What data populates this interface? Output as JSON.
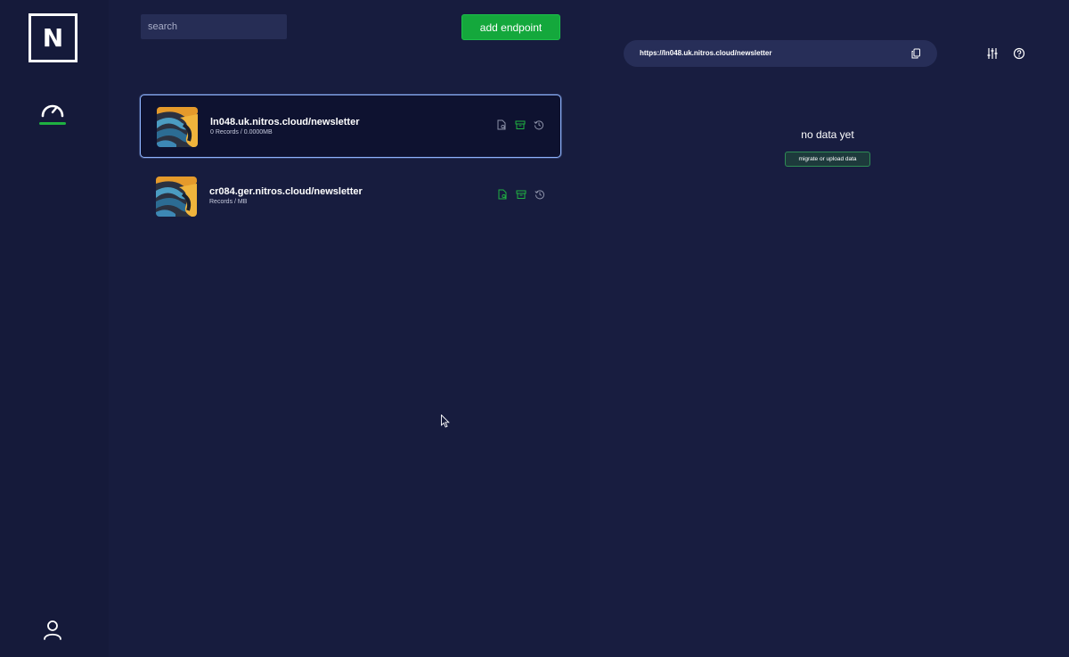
{
  "sidebar": {
    "logo_letter": "N",
    "nav": [
      {
        "icon": "speedometer-icon",
        "active": true
      }
    ],
    "account_icon": "user-icon",
    "accent": "#1fb141"
  },
  "toolbar": {
    "search_placeholder": "search",
    "add_label": "add endpoint",
    "add_color": "#14a83c"
  },
  "endpoints": [
    {
      "title": "ln048.uk.nitros.cloud/newsletter",
      "subtitle": "0 Records / 0.0000MB",
      "selected": true,
      "actions_color": "#1fb141"
    },
    {
      "title": "cr084.ger.nitros.cloud/newsletter",
      "subtitle": "Records / MB",
      "selected": false,
      "actions_color": "#1fb141"
    }
  ],
  "detail": {
    "url": "https://ln048.uk.nitros.cloud/newsletter",
    "empty_title": "no data yet",
    "migrate_label": "migrate or upload data"
  },
  "colors": {
    "background": "#161b3c",
    "selected_border": "#8fb4ff"
  }
}
